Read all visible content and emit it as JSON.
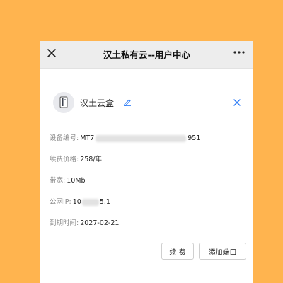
{
  "header": {
    "title": "汉土私有云--用户中心",
    "close_icon": "close-icon",
    "more_icon": "more-icon"
  },
  "device": {
    "name": "汉土云盒",
    "icon": "device-icon",
    "edit_icon": "edit-icon",
    "remove_icon": "close-icon"
  },
  "info": {
    "serial": {
      "label": "设备编号:",
      "value_start": "MT7",
      "value_end": "951"
    },
    "renewal_price": {
      "label": "续费价格:",
      "value": "258/年"
    },
    "bandwidth": {
      "label": "带宽:",
      "value": "10Mb"
    },
    "public_ip": {
      "label": "公网IP:",
      "value_start": "10",
      "value_end": "5.1"
    },
    "expire": {
      "label": "到期时间:",
      "value": "2027-02-21"
    }
  },
  "actions": {
    "renew": "续 费",
    "add_port": "添加端口"
  },
  "colors": {
    "background": "#ffb44f",
    "accent": "#2e7cf6"
  }
}
